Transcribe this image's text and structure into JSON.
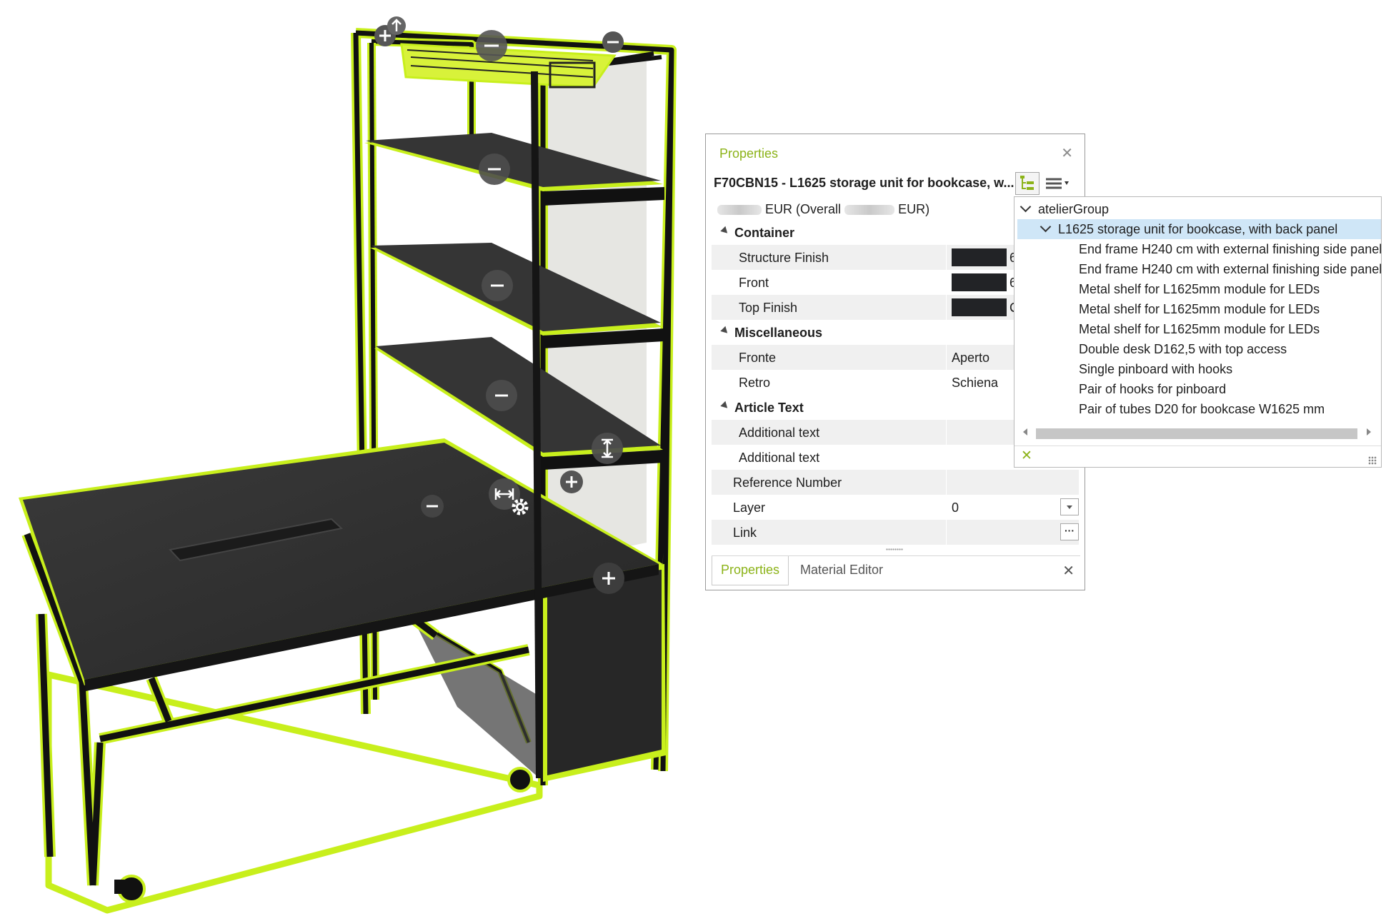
{
  "properties_panel": {
    "title": "Properties",
    "article_heading": "F70CBN15 - L1625 storage unit for bookcase, w...",
    "price_currency": "EUR (Overall",
    "price_currency_end": "EUR)",
    "categories": {
      "container": "Container",
      "miscellaneous": "Miscellaneous",
      "article_text": "Article Text"
    },
    "rows": {
      "structure_finish": {
        "label": "Structure Finish",
        "value": "6"
      },
      "front": {
        "label": "Front",
        "value": "6"
      },
      "top_finish": {
        "label": "Top Finish",
        "value": "C"
      },
      "fronte": {
        "label": "Fronte",
        "value": "Aperto"
      },
      "retro": {
        "label": "Retro",
        "value": "Schiena"
      },
      "additional_text_1": {
        "label": "Additional text",
        "value": ""
      },
      "additional_text_2": {
        "label": "Additional text",
        "value": ""
      },
      "reference_number": {
        "label": "Reference Number",
        "value": ""
      },
      "layer": {
        "label": "Layer",
        "value": "0"
      },
      "link": {
        "label": "Link",
        "value": ""
      }
    },
    "link_button": "···",
    "tabs": [
      "Properties",
      "Material Editor"
    ]
  },
  "tree": {
    "root": "atelierGroup",
    "selected": "L1625 storage unit for bookcase, with back panel",
    "children": [
      "End frame H240 cm with external finishing side panel",
      "End frame H240 cm with external finishing side panel",
      "Metal shelf for L1625mm module for LEDs",
      "Metal shelf for L1625mm module for LEDs",
      "Metal shelf for L1625mm module for LEDs",
      "Double desk D162,5 with top access",
      "Single pinboard with hooks",
      "Pair of hooks for pinboard",
      "Pair of tubes D20 for bookcase W1625 mm"
    ]
  },
  "colors": {
    "selection_outline": "#c8ef1c",
    "accent_green": "#8cb319",
    "furniture_dark": "#2e2e2e",
    "finish_swatch": "#222326",
    "tree_selection": "#cfe6f7"
  },
  "scene_icons": [
    "plus-icon",
    "minus-icon",
    "height-resize-icon",
    "width-resize-icon",
    "gear-icon",
    "arrow-up-icon"
  ]
}
